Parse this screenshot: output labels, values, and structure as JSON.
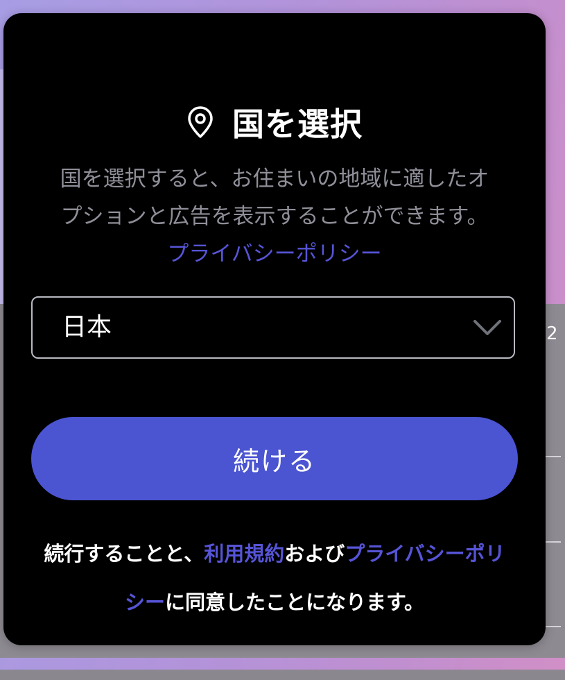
{
  "modal": {
    "title": "国を選択",
    "icon": "map-pin-icon",
    "description_line1": "国を選択すると、お住まいの地域に適したオ",
    "description_line2": "プションと広告を表示することができます。",
    "privacy_link": "プライバシーポリシー",
    "country_select": {
      "value": "日本",
      "icon": "chevron-down-icon"
    },
    "continue_label": "続ける",
    "terms": {
      "prefix": "続行することと、",
      "terms_link": "利用規約",
      "middle": "および",
      "privacy_link_part1": "プライバシーポリ",
      "privacy_link_part2": "シー",
      "suffix": "に同意したことになります。"
    }
  },
  "background": {
    "edge_text_1": "2"
  },
  "colors": {
    "accent": "#4b54d1",
    "link": "#5654d6",
    "modal_bg": "#000000",
    "description": "#8f8f99"
  }
}
